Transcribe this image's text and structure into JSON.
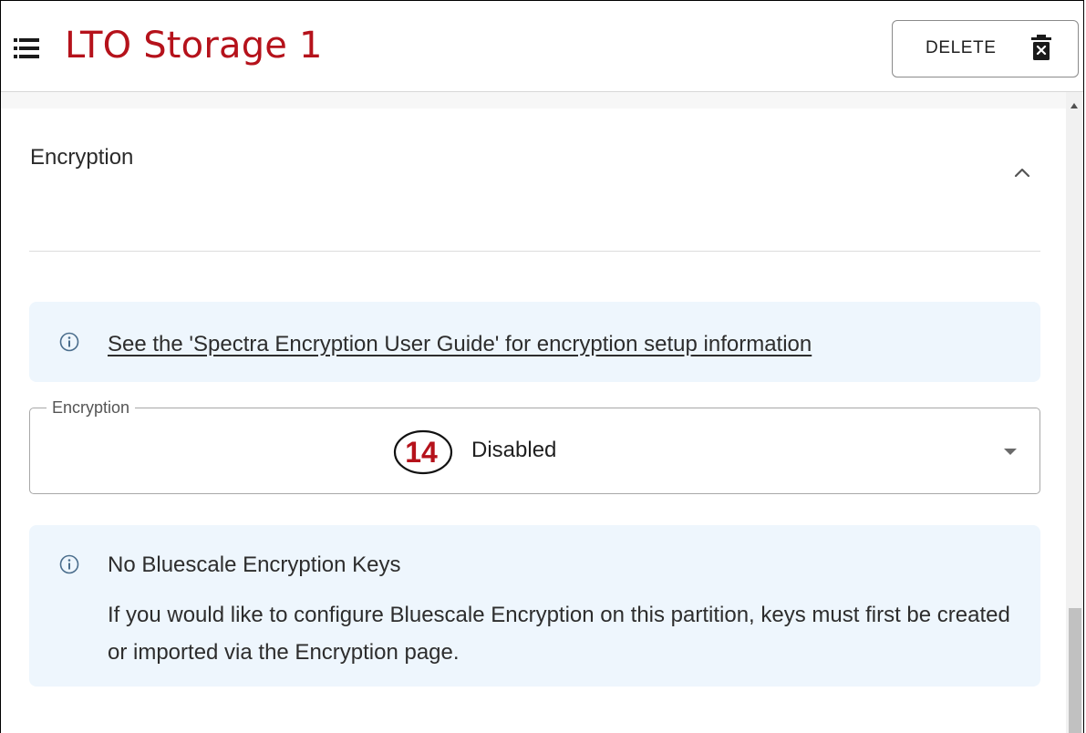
{
  "header": {
    "title": "LTO Storage 1",
    "menu_icon": "list-icon",
    "delete_label": "DELETE",
    "delete_icon": "trash-icon",
    "title_color": "#b5121b"
  },
  "section": {
    "title": "Encryption",
    "toggle_icon": "chevron-up-icon"
  },
  "guide_info": {
    "icon": "info-icon",
    "link_text": "See the 'Spectra Encryption User Guide' for encryption setup information"
  },
  "encryption_select": {
    "label": "Encryption",
    "value": "Disabled",
    "callout_number": "14",
    "callout_color": "#b5121b"
  },
  "keys_info": {
    "icon": "info-icon",
    "title": "No Bluescale Encryption Keys",
    "body": "If you would like to configure Bluescale Encryption on this partition, keys must first be created or imported via the Encryption page."
  }
}
